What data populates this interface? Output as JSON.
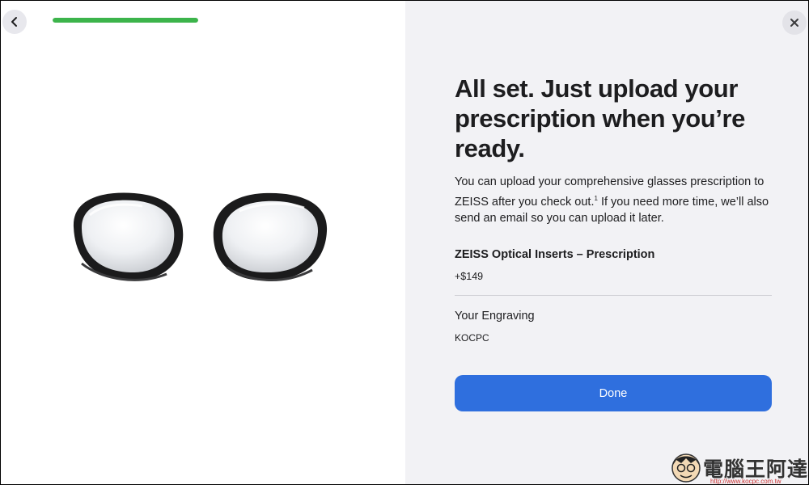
{
  "navigation": {
    "back_icon": "chevron-left-icon",
    "close_icon": "close-icon"
  },
  "progress": {
    "fraction": 1.0,
    "color": "#3cb44b"
  },
  "product_image": {
    "alt": "ZEISS Optical Inserts"
  },
  "panel": {
    "headline": "All set. Just upload your prescription when you’re ready.",
    "body_before": "You can upload your comprehensive glasses prescription to ZEISS after you check out.",
    "body_footnote": "1",
    "body_after": " If you need more time, we’ll also send an email so you can upload it later.",
    "item_title": "ZEISS Optical Inserts – Prescription",
    "item_price": "+$149",
    "engraving_label": "Your Engraving",
    "engraving_value": "KOCPC",
    "done_label": "Done",
    "accent": "#2f6fde"
  },
  "watermark": {
    "text": "電腦王阿達",
    "url": "http://www.kocpc.com.tw"
  }
}
